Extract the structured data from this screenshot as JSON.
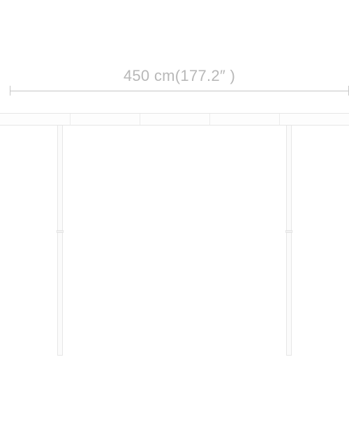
{
  "dimension": {
    "label": "450 cm(177.2″ )"
  },
  "colors": {
    "text_gray": "#b8b8b8",
    "line_gray": "#c6c6c6",
    "edge_light": "#e6e6e6"
  }
}
